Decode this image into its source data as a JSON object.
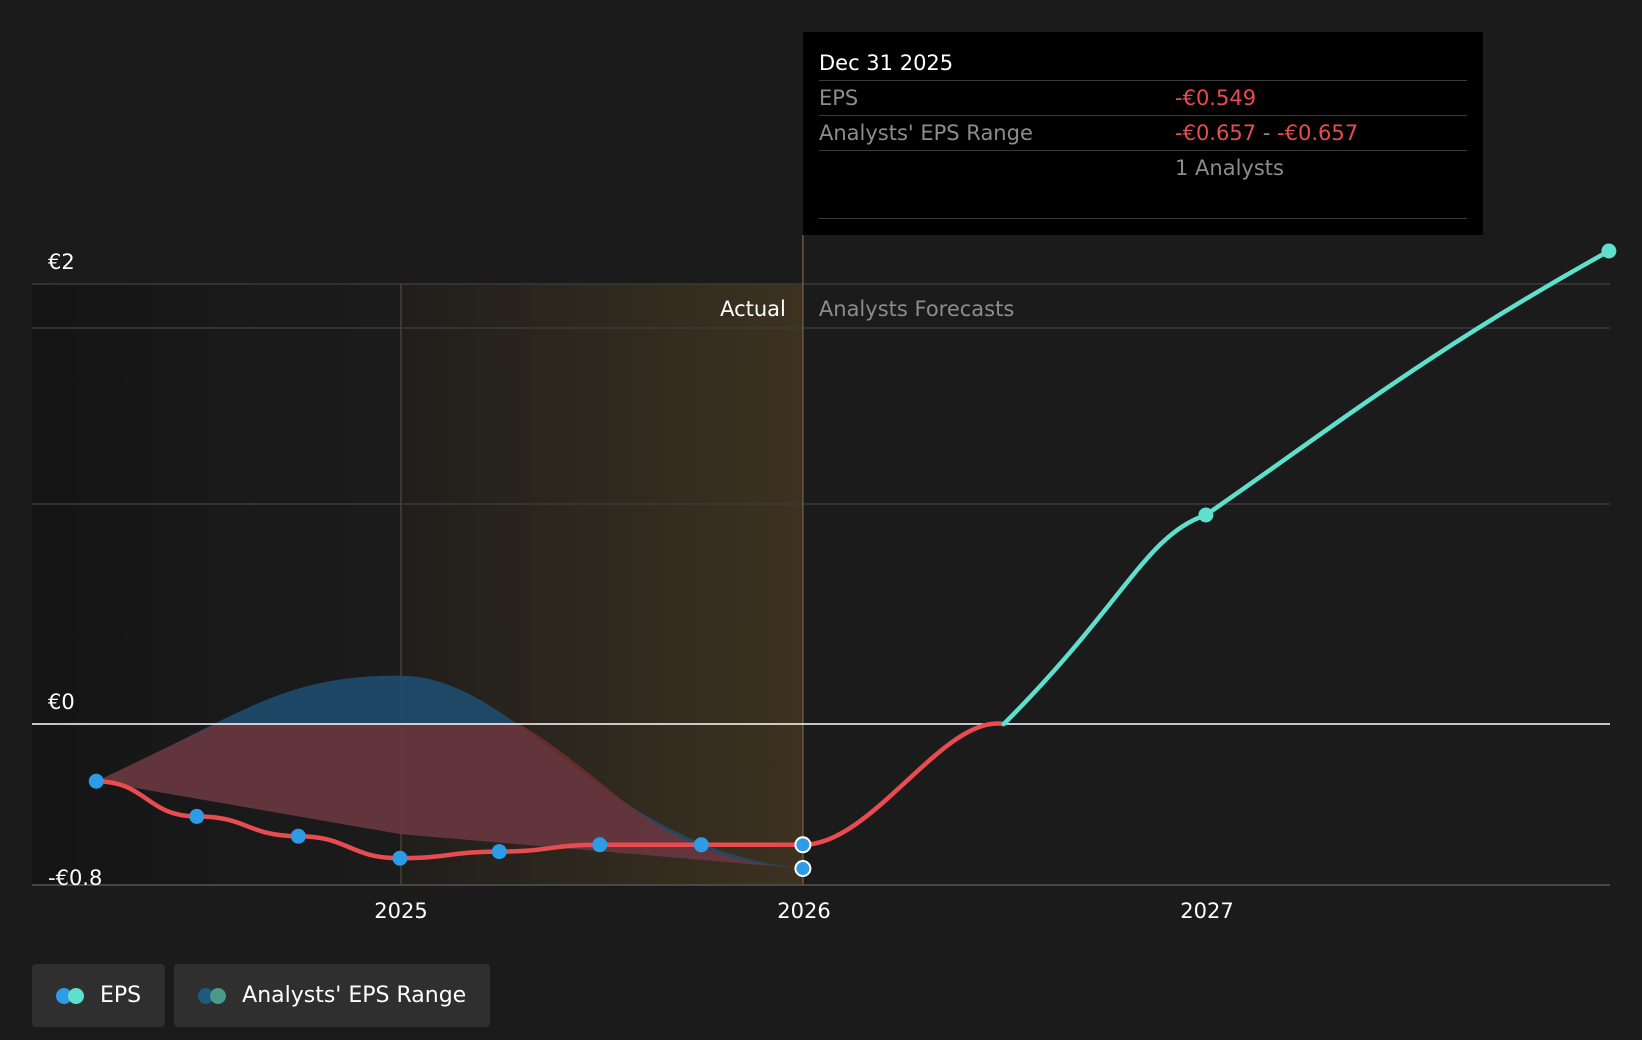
{
  "chart_data": {
    "type": "line",
    "x_ticks": [
      "2025",
      "2026",
      "2027"
    ],
    "y_ticks": [
      "€2",
      "€0",
      "-€0.8"
    ],
    "ylim": [
      -0.8,
      2.0
    ],
    "sections": {
      "actual": "Actual",
      "forecast": "Analysts Forecasts"
    },
    "series": [
      {
        "name": "EPS",
        "points": [
          {
            "x": "2024-03-31",
            "y": -0.26
          },
          {
            "x": "2024-06-30",
            "y": -0.42
          },
          {
            "x": "2024-09-30",
            "y": -0.51
          },
          {
            "x": "2024-12-31",
            "y": -0.61
          },
          {
            "x": "2025-03-31",
            "y": -0.58
          },
          {
            "x": "2025-06-30",
            "y": -0.549
          },
          {
            "x": "2025-09-30",
            "y": -0.549
          },
          {
            "x": "2025-12-31",
            "y": -0.549
          },
          {
            "x": "2026-12-31",
            "y": 0.95
          },
          {
            "x": "2027-12-31",
            "y": 2.15
          }
        ]
      },
      {
        "name": "Analysts' EPS Range",
        "points": [
          {
            "x": "2024-03-31",
            "low": -0.26,
            "high": -0.26
          },
          {
            "x": "2024-12-31",
            "low": -0.5,
            "high": 0.22
          },
          {
            "x": "2025-12-31",
            "low": -0.657,
            "high": -0.657
          }
        ],
        "forecast_point": {
          "x": "2025-12-31",
          "y": -0.657
        }
      }
    ],
    "colors": {
      "eps_negative": "#e84c50",
      "eps_positive": "#5ee0cc",
      "actual_point": "#2e9be6",
      "range_upper": "#1e4c6e",
      "range_lower": "#7a2f2f",
      "actual_band": "#3d3220"
    },
    "tooltip": {
      "date": "Dec 31 2025",
      "eps_label": "EPS",
      "eps_value": "-€0.549",
      "range_label": "Analysts' EPS Range",
      "range_low": "-€0.657",
      "range_sep": "-",
      "range_high": "-€0.657",
      "analysts": "1 Analysts"
    },
    "legend": [
      "EPS",
      "Analysts' EPS Range"
    ]
  }
}
